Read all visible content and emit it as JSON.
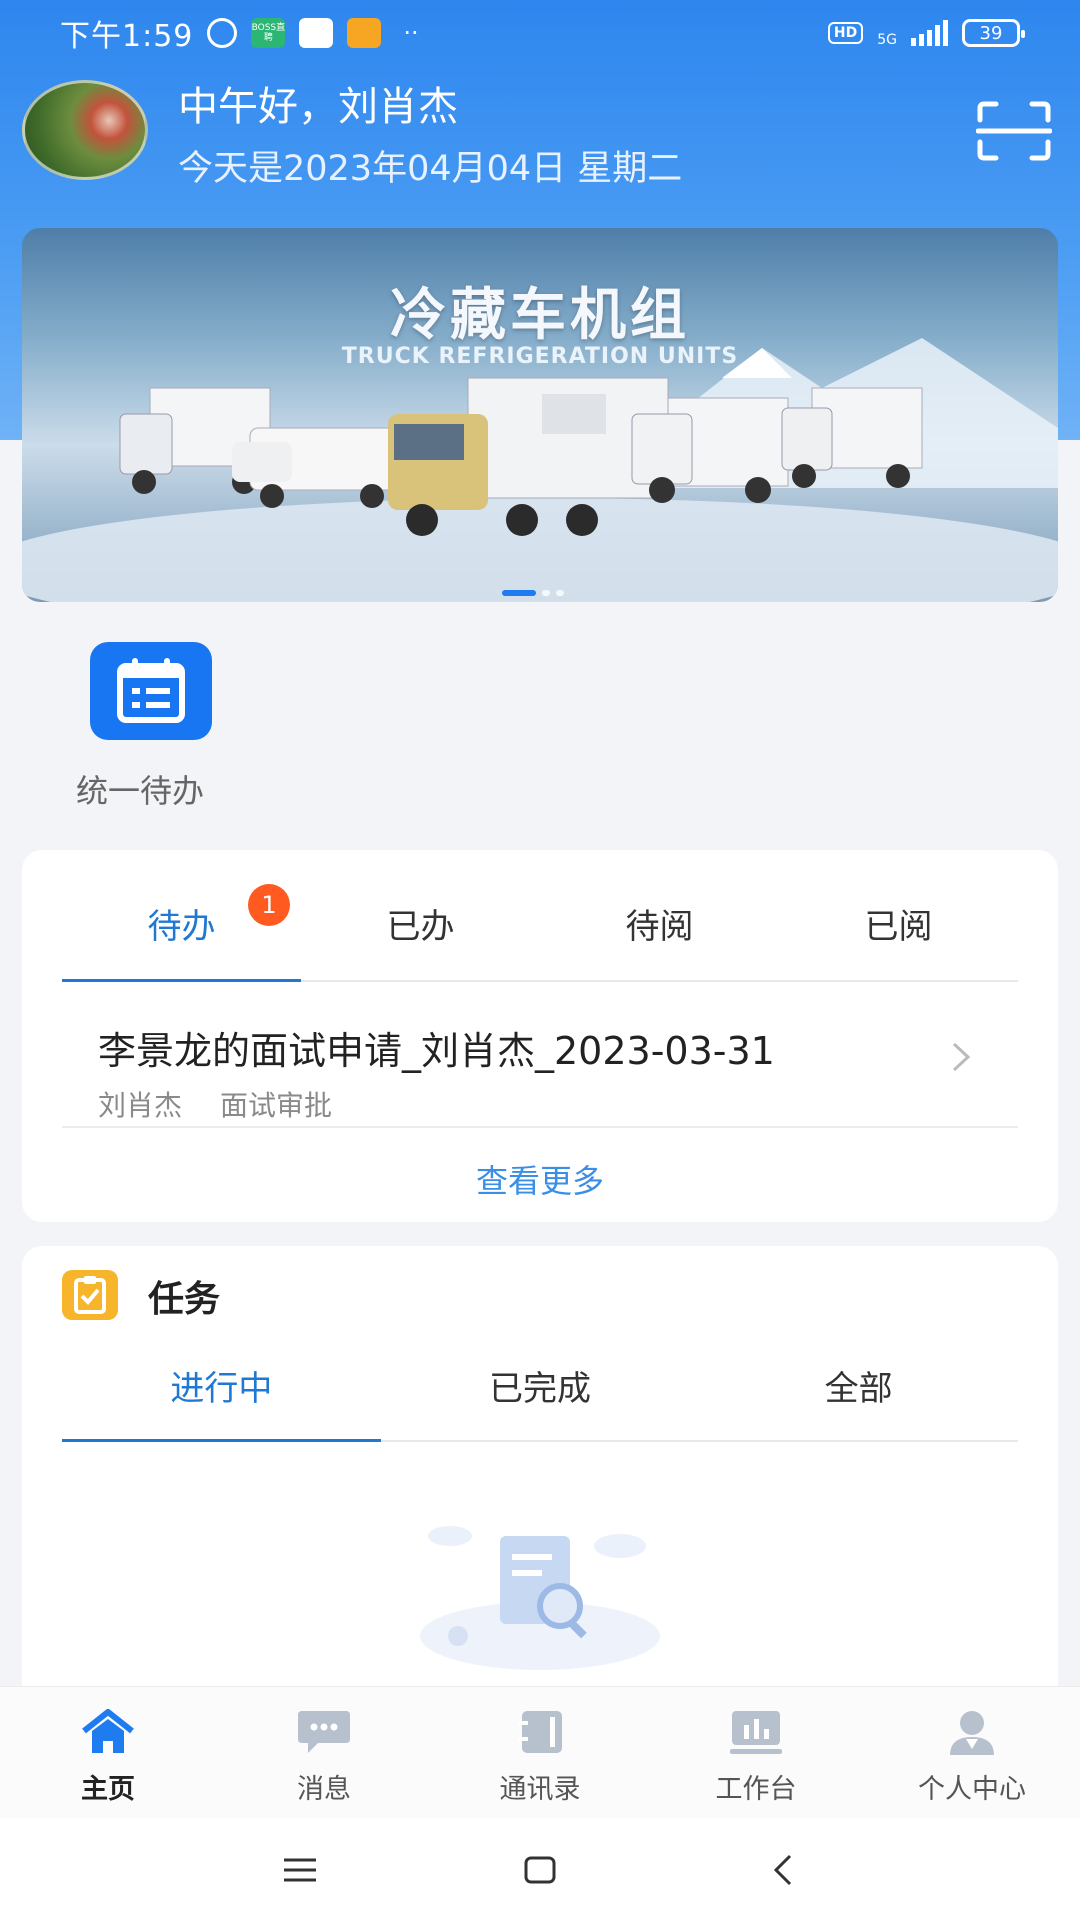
{
  "status_bar": {
    "time": "下午1:59",
    "boss_label": "BOSS直聘",
    "hd": "HD",
    "network": "5G",
    "battery": "39"
  },
  "header": {
    "greeting": "中午好，刘肖杰",
    "date_line": "今天是2023年04月04日 星期二"
  },
  "banner": {
    "title": "冷藏车机组",
    "subtitle": "TRUCK REFRIGERATION UNITS",
    "active_slide": 1,
    "slide_count": 3
  },
  "quick_entries": [
    {
      "label": "统一待办",
      "icon": "calendar-list-icon"
    }
  ],
  "todo": {
    "tabs": [
      {
        "label": "待办",
        "badge": "1",
        "active": true
      },
      {
        "label": "已办"
      },
      {
        "label": "待阅"
      },
      {
        "label": "已阅"
      }
    ],
    "items": [
      {
        "title": "李景龙的面试申请_刘肖杰_2023-03-31",
        "person": "刘肖杰",
        "type": "面试审批"
      }
    ],
    "see_more": "查看更多"
  },
  "tasks": {
    "title": "任务",
    "tabs": [
      {
        "label": "进行中",
        "active": true
      },
      {
        "label": "已完成"
      },
      {
        "label": "全部"
      }
    ]
  },
  "bottom_nav": [
    {
      "label": "主页",
      "icon": "home-icon",
      "active": true
    },
    {
      "label": "消息",
      "icon": "message-icon"
    },
    {
      "label": "通讯录",
      "icon": "contacts-icon"
    },
    {
      "label": "工作台",
      "icon": "workbench-icon"
    },
    {
      "label": "个人中心",
      "icon": "profile-icon"
    }
  ],
  "colors": {
    "primary": "#1976F2",
    "tab_active": "#1F78D1",
    "badge": "#FF5A1F",
    "task_icon": "#F7B52C"
  }
}
